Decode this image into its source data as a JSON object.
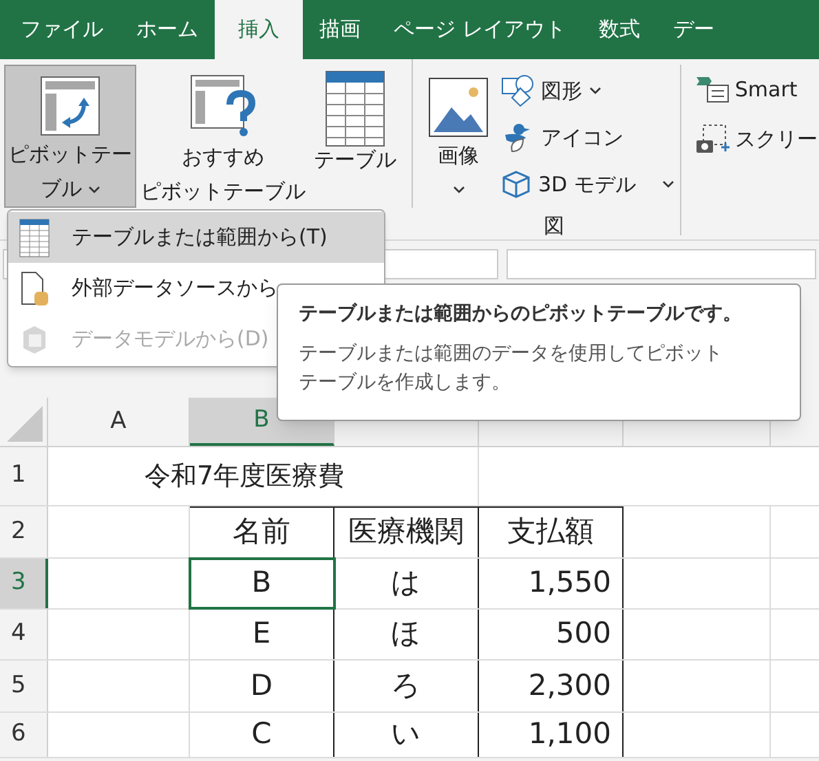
{
  "tabs": [
    {
      "label": "ファイル",
      "selected": false
    },
    {
      "label": "ホーム",
      "selected": false
    },
    {
      "label": "挿入",
      "selected": true
    },
    {
      "label": "描画",
      "selected": false
    },
    {
      "label": "ページ レイアウト",
      "selected": false
    },
    {
      "label": "数式",
      "selected": false
    },
    {
      "label": "デー",
      "selected": false
    }
  ],
  "ribbon": {
    "large_buttons": [
      {
        "kind": "pivot",
        "lines": [
          "ピボットテー",
          "ブル"
        ],
        "dropdown": true,
        "selected": true
      },
      {
        "kind": "recommended",
        "lines": [
          "おすすめ",
          "ピボットテーブル"
        ],
        "dropdown": false,
        "selected": false
      },
      {
        "kind": "table",
        "lines": [
          "テーブル"
        ],
        "dropdown": false,
        "selected": false
      },
      {
        "kind": "image",
        "lines": [
          "画像"
        ],
        "dropdown": true,
        "selected": false
      }
    ],
    "small_buttons": [
      {
        "kind": "shapes",
        "label": "図形",
        "dropdown": true
      },
      {
        "kind": "icons",
        "label": "アイコン",
        "dropdown": false
      },
      {
        "kind": "model3d",
        "label": "3D モデル",
        "dropdown": true
      }
    ],
    "group_label": "図",
    "cut_buttons": [
      {
        "kind": "smartart",
        "label": "Smart"
      },
      {
        "kind": "screenshot",
        "label": "スクリー"
      }
    ]
  },
  "menu": [
    {
      "kind": "table",
      "label": "テーブルまたは範囲から(T)",
      "selected": true,
      "disabled": false
    },
    {
      "kind": "external",
      "label": "外部データソースから",
      "selected": false,
      "disabled": false
    },
    {
      "kind": "model",
      "label": "データモデルから(D)",
      "selected": false,
      "disabled": true
    }
  ],
  "tooltip": {
    "title": "テーブルまたは範囲からのピボットテーブルです。",
    "body": [
      "テーブルまたは範囲のデータを使用してピボット",
      "テーブルを作成します。"
    ]
  },
  "sheet": {
    "columns": [
      {
        "label": "A",
        "selected": false
      },
      {
        "label": "B",
        "selected": true
      }
    ],
    "rows": [
      {
        "label": "1",
        "selected": false,
        "title": "令和7年度医療費"
      },
      {
        "label": "2",
        "selected": false,
        "cells": [
          "名前",
          "医療機関",
          "支払額"
        ]
      },
      {
        "label": "3",
        "selected": true,
        "cells": [
          "B",
          "は",
          "1,550"
        ]
      },
      {
        "label": "4",
        "selected": false,
        "cells": [
          "E",
          "ほ",
          "500"
        ]
      },
      {
        "label": "5",
        "selected": false,
        "cells": [
          "D",
          "ろ",
          "2,300"
        ]
      },
      {
        "label": "6",
        "selected": false,
        "cells": [
          "C",
          "い",
          "1,100"
        ]
      }
    ]
  }
}
